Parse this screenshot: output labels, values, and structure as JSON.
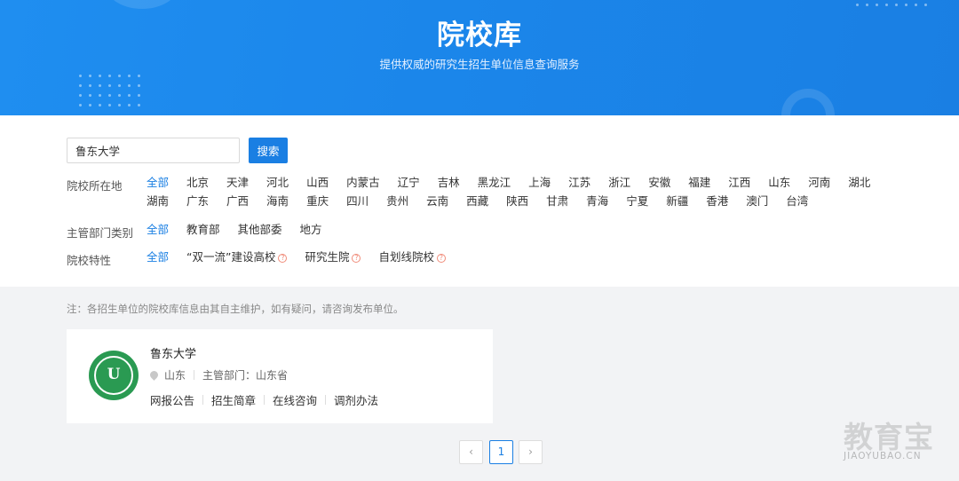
{
  "banner": {
    "title": "院校库",
    "subtitle": "提供权威的研究生招生单位信息查询服务"
  },
  "search": {
    "value": "鲁东大学",
    "button_label": "搜索"
  },
  "filters": {
    "location": {
      "label": "院校所在地",
      "options": [
        "全部",
        "北京",
        "天津",
        "河北",
        "山西",
        "内蒙古",
        "辽宁",
        "吉林",
        "黑龙江",
        "上海",
        "江苏",
        "浙江",
        "安徽",
        "福建",
        "江西",
        "山东",
        "河南",
        "湖北",
        "湖南",
        "广东",
        "广西",
        "海南",
        "重庆",
        "四川",
        "贵州",
        "云南",
        "西藏",
        "陕西",
        "甘肃",
        "青海",
        "宁夏",
        "新疆",
        "香港",
        "澳门",
        "台湾"
      ],
      "selected": "全部"
    },
    "department": {
      "label": "主管部门类别",
      "options": [
        "全部",
        "教育部",
        "其他部委",
        "地方"
      ],
      "selected": "全部"
    },
    "features": {
      "label": "院校特性",
      "options": [
        "全部",
        "“双一流”建设高校",
        "研究生院",
        "自划线院校"
      ],
      "selected": "全部",
      "help_icon": "?"
    }
  },
  "note": "注：各招生单位的院校库信息由其自主维护，如有疑问，请咨询发布单位。",
  "result": {
    "logo_mark": "U",
    "name": "鲁东大学",
    "location_icon": "map-pin-icon",
    "province": "山东",
    "department": "主管部门：山东省",
    "links": [
      "网报公告",
      "招生简章",
      "在线咨询",
      "调剂办法"
    ]
  },
  "pagination": {
    "prev": "‹",
    "current": "1",
    "next": "›"
  },
  "watermark": {
    "logo": "教育宝",
    "url": "JIAOYUBAO.CN"
  },
  "colors": {
    "primary": "#1a7fe3",
    "banner": "#1f8ef0",
    "school_green": "#2a9a52",
    "help_icon": "#f08c7a"
  }
}
